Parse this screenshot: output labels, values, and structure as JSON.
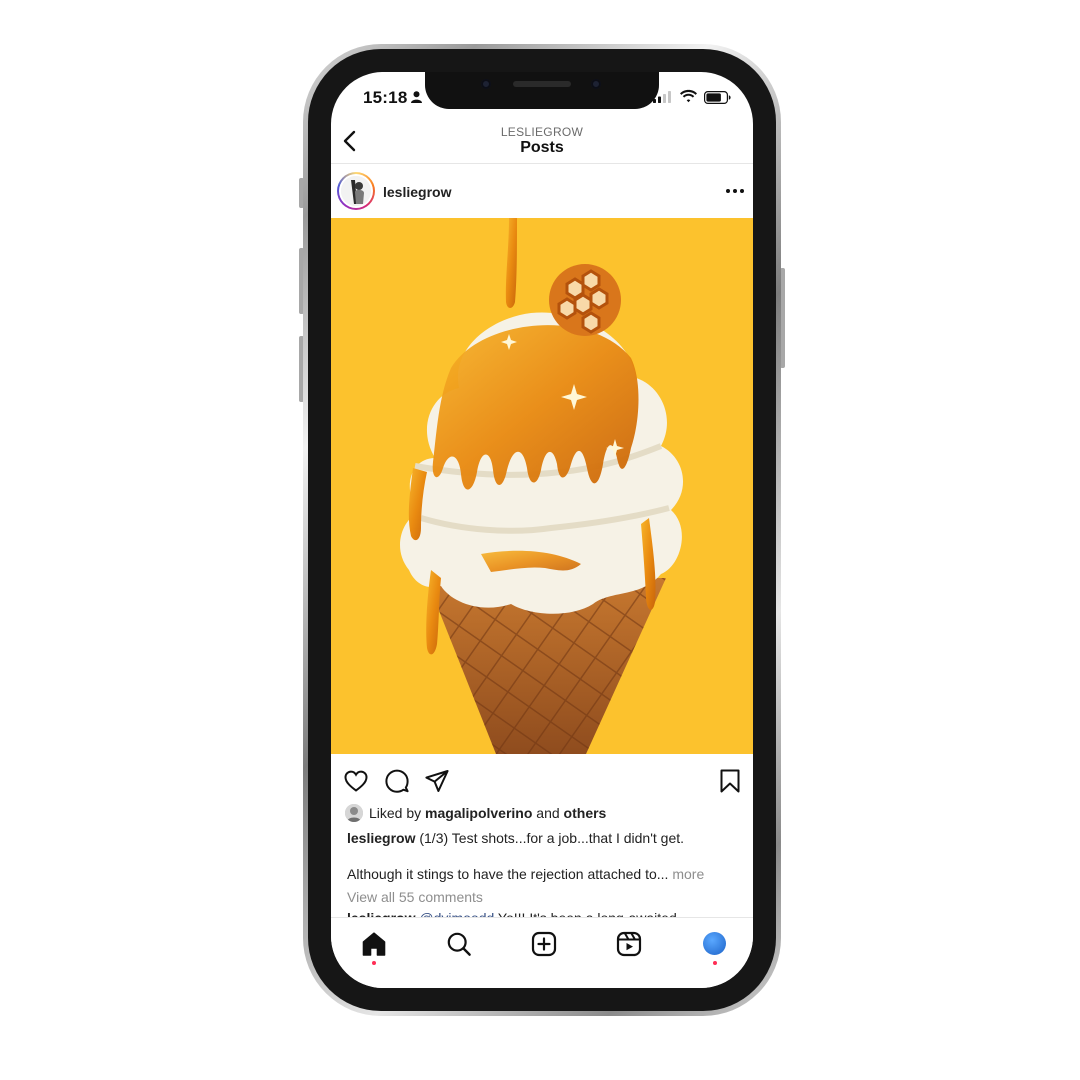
{
  "status_bar": {
    "time": "15:18",
    "icons": [
      "person-icon",
      "cellular-signal-icon",
      "wifi-icon",
      "battery-icon"
    ]
  },
  "header": {
    "account": "LESLIEGROW",
    "title": "Posts",
    "back_icon": "chevron-left-icon"
  },
  "post": {
    "username": "lesliegrow",
    "more_icon": "ellipsis-icon",
    "image_background": "#fcc22d",
    "actions": [
      "heart-icon",
      "comment-icon",
      "share-icon",
      "bookmark-icon"
    ],
    "likes": {
      "prefix": "Liked by",
      "user": "magalipolverino",
      "joiner": "and",
      "others": "others"
    },
    "caption": {
      "username": "lesliegrow",
      "line1": "(1/3) Test shots...for a job...that I didn't get.",
      "line2": "Although it stings to have the rejection attached to...",
      "more": "more"
    },
    "view_comments": "View all 55 comments",
    "comment_peek": {
      "username": "lesliegrow",
      "mention": "@dvjmoodd",
      "text": "Yo!!! It's been a long-awaited"
    }
  },
  "bottom_nav": {
    "items": [
      "home-icon",
      "search-icon",
      "new-post-icon",
      "reels-icon",
      "profile-avatar"
    ],
    "active_color": "#ff2d55"
  }
}
